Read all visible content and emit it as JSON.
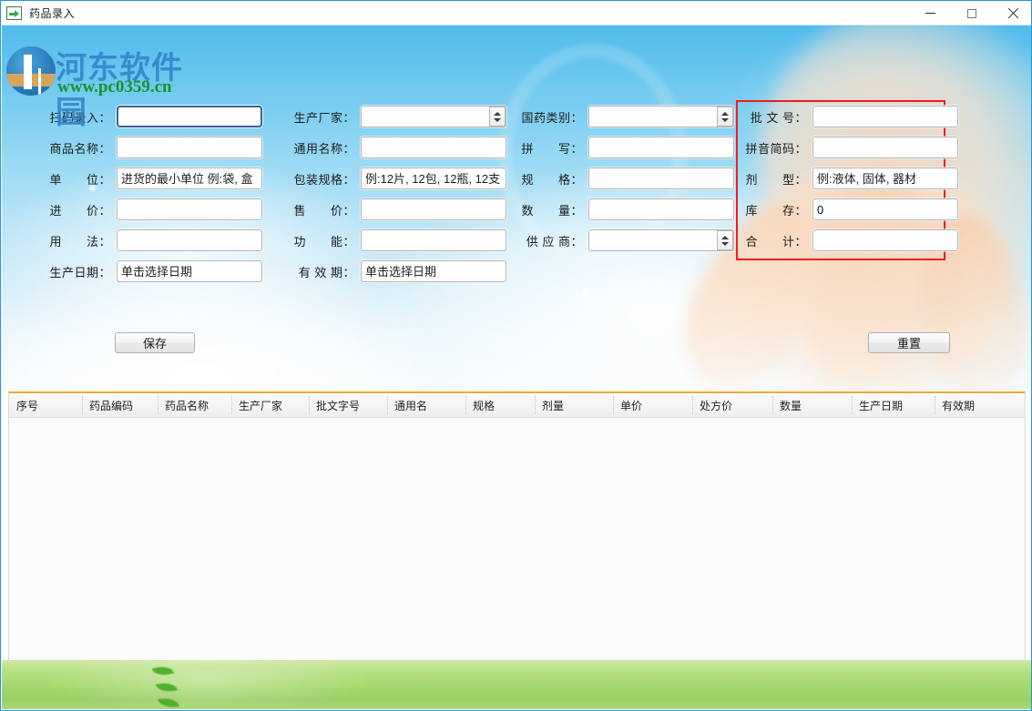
{
  "window": {
    "title": "药品录入",
    "icon": "green-arrow-icon",
    "controls": {
      "minimize": "–",
      "maximize": "□",
      "close": "✕"
    }
  },
  "watermark": {
    "site_name": "河东软件园",
    "url": "www.pc0359.cn"
  },
  "form": {
    "columns": [
      {
        "fields": [
          {
            "label": "扫码录入：",
            "value": "",
            "placeholder": "",
            "type": "text",
            "focused": true,
            "name": "scan-entry"
          },
          {
            "label": "商品名称：",
            "value": "",
            "placeholder": "",
            "type": "text",
            "focused": false,
            "name": "product-name"
          },
          {
            "label": "单　　位：",
            "value": "",
            "placeholder": "进货的最小单位 例:袋, 盒",
            "type": "text",
            "focused": false,
            "name": "unit"
          },
          {
            "label": "进　　价：",
            "value": "",
            "placeholder": "",
            "type": "text",
            "focused": false,
            "name": "purchase-price"
          },
          {
            "label": "用　　法：",
            "value": "",
            "placeholder": "",
            "type": "text",
            "focused": false,
            "name": "usage"
          },
          {
            "label": "生产日期：",
            "value": "",
            "placeholder": "单击选择日期",
            "type": "date",
            "focused": false,
            "name": "production-date"
          }
        ]
      },
      {
        "fields": [
          {
            "label": "生产厂家：",
            "value": "",
            "placeholder": "",
            "type": "combo",
            "focused": false,
            "name": "manufacturer"
          },
          {
            "label": "通用名称：",
            "value": "",
            "placeholder": "",
            "type": "text",
            "focused": false,
            "name": "generic-name"
          },
          {
            "label": "包装规格：",
            "value": "",
            "placeholder": "例:12片, 12包, 12瓶, 12支",
            "type": "text",
            "focused": false,
            "name": "package-spec"
          },
          {
            "label": "售　　价：",
            "value": "",
            "placeholder": "",
            "type": "text",
            "focused": false,
            "name": "sale-price"
          },
          {
            "label": "功　　能：",
            "value": "",
            "placeholder": "",
            "type": "text",
            "focused": false,
            "name": "function"
          },
          {
            "label": "有 效 期：",
            "value": "",
            "placeholder": "单击选择日期",
            "type": "date",
            "focused": false,
            "name": "expiry-date"
          }
        ]
      },
      {
        "fields": [
          {
            "label": "国药类别：",
            "value": "",
            "placeholder": "",
            "type": "combo",
            "focused": false,
            "name": "drug-category"
          },
          {
            "label": "拼　　写：",
            "value": "",
            "placeholder": "",
            "type": "text",
            "focused": false,
            "name": "spelling"
          },
          {
            "label": "规　　格：",
            "value": "",
            "placeholder": "",
            "type": "text",
            "focused": false,
            "name": "specification"
          },
          {
            "label": "数　　量：",
            "value": "",
            "placeholder": "",
            "type": "text",
            "focused": false,
            "name": "quantity"
          },
          {
            "label": "供 应 商：",
            "value": "",
            "placeholder": "",
            "type": "combo",
            "focused": false,
            "name": "supplier"
          }
        ]
      },
      {
        "highlighted": true,
        "highlight_color": "#ee1c25",
        "fields": [
          {
            "label": "批 文 号：",
            "value": "",
            "placeholder": "",
            "type": "text",
            "focused": false,
            "name": "approval-number"
          },
          {
            "label": "拼音简码：",
            "value": "",
            "placeholder": "",
            "type": "text",
            "focused": false,
            "name": "pinyin-code"
          },
          {
            "label": "剂　　型：",
            "value": "",
            "placeholder": "例:液体, 固体, 器材",
            "type": "text",
            "focused": false,
            "name": "dosage-form"
          },
          {
            "label": "库　　存：",
            "value": "0",
            "placeholder": "",
            "type": "text",
            "focused": false,
            "name": "stock"
          },
          {
            "label": "合　　计：",
            "value": "",
            "placeholder": "",
            "type": "text",
            "focused": false,
            "name": "total"
          }
        ]
      }
    ]
  },
  "buttons": {
    "save": "保存",
    "reset": "重置"
  },
  "grid": {
    "headers": [
      "序号",
      "药品编码",
      "药品名称",
      "生产厂家",
      "批文字号",
      "通用名",
      "规格",
      "剂量",
      "单价",
      "处方价",
      "数量",
      "生产日期",
      "有效期"
    ],
    "rows": []
  }
}
